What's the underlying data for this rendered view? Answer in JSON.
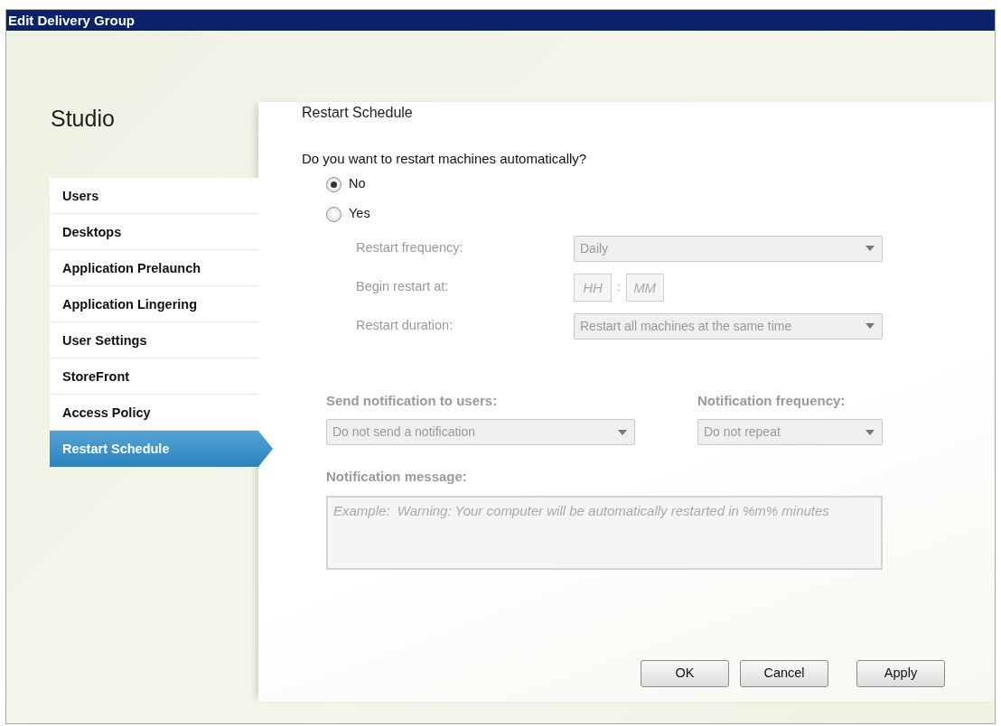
{
  "window": {
    "title": "Edit Delivery Group"
  },
  "sidebar": {
    "title": "Studio",
    "items": [
      {
        "label": "Users",
        "selected": false
      },
      {
        "label": "Desktops",
        "selected": false
      },
      {
        "label": "Application Prelaunch",
        "selected": false
      },
      {
        "label": "Application Lingering",
        "selected": false
      },
      {
        "label": "User Settings",
        "selected": false
      },
      {
        "label": "StoreFront",
        "selected": false
      },
      {
        "label": "Access Policy",
        "selected": false
      },
      {
        "label": "Restart Schedule",
        "selected": true
      }
    ]
  },
  "page": {
    "heading": "Restart Schedule",
    "question": "Do you want to restart machines automatically?",
    "options": [
      {
        "label": "No",
        "selected": true
      },
      {
        "label": "Yes",
        "selected": false
      }
    ],
    "schedule_fields": [
      {
        "kind": "dropdown",
        "label": "Restart frequency:",
        "value": "Daily",
        "disabled": true
      },
      {
        "kind": "time",
        "label": "Begin restart at:",
        "hours_placeholder": "HH",
        "separator": ":",
        "minutes_placeholder": "MM",
        "disabled": true
      },
      {
        "kind": "dropdown",
        "label": "Restart duration:",
        "value": "Restart all machines at the same time",
        "disabled": true
      }
    ],
    "notification": {
      "send": {
        "label": "Send notification to users:",
        "value": "Do not send a notification",
        "disabled": true
      },
      "frequency": {
        "label": "Notification frequency:",
        "value": "Do not repeat",
        "disabled": true
      },
      "message": {
        "label": "Notification message:",
        "placeholder": "Example:  Warning: Your computer will be automatically restarted in %m% minutes",
        "disabled": true
      }
    }
  },
  "buttons": [
    {
      "label": "OK"
    },
    {
      "label": "Cancel"
    },
    {
      "label": "Apply"
    }
  ]
}
